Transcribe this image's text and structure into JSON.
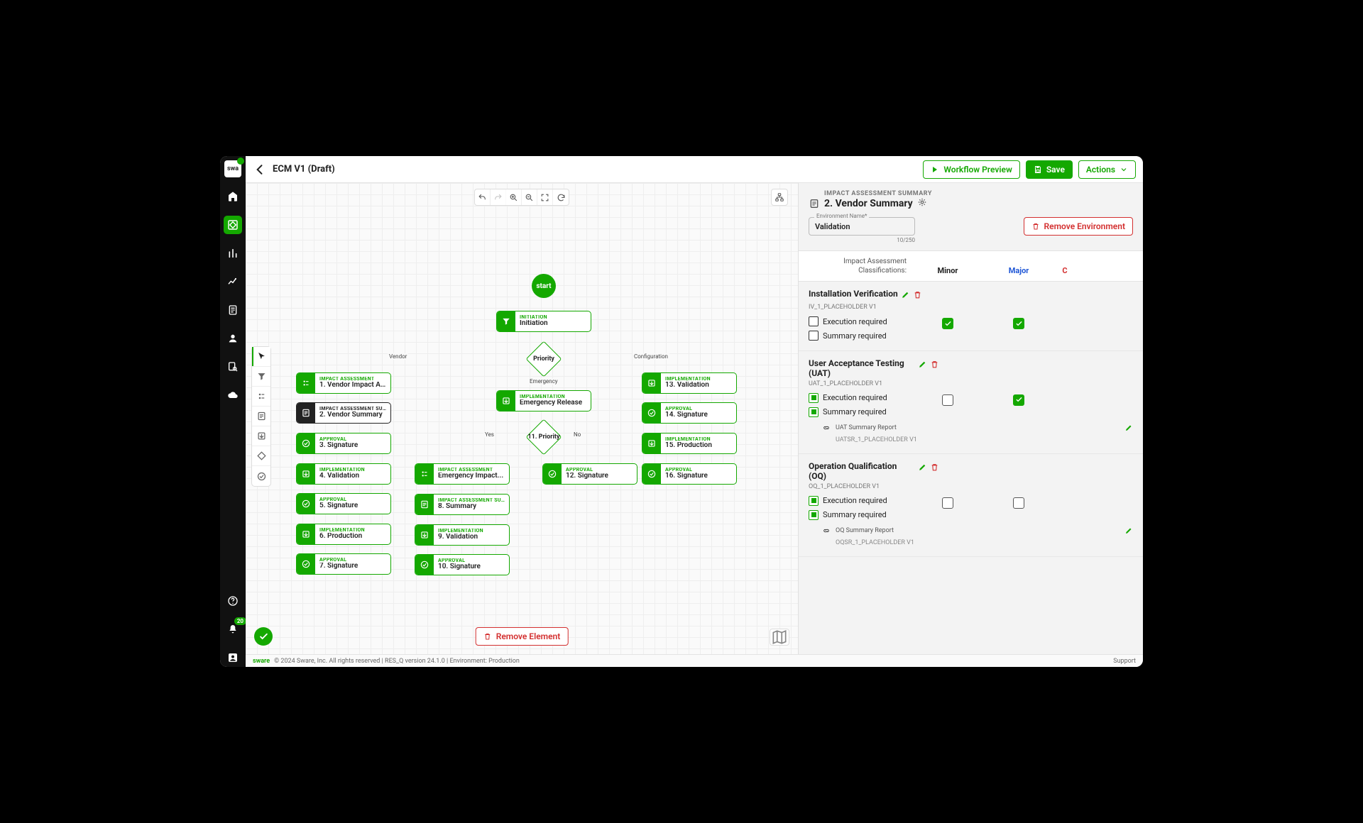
{
  "page": {
    "title": "ECM V1 (Draft)"
  },
  "topbar": {
    "preview": "Workflow Preview",
    "save": "Save",
    "actions": "Actions"
  },
  "footer": {
    "brand": "sware",
    "copyright": "© 2024 Sware, Inc. All rights reserved | RES_Q version 24.1.0 | Environment: Production",
    "support": "Support"
  },
  "canvas": {
    "remove_element": "Remove Element",
    "start": "start",
    "diamonds": {
      "priority": "Priority",
      "priority2": "11. Priority"
    },
    "edge_labels": {
      "vendor": "Vendor",
      "configuration": "Configuration",
      "emergency": "Emergency",
      "yes": "Yes",
      "no": "No"
    },
    "nodes": {
      "initiation": {
        "cat": "INITIATION",
        "lbl": "Initiation"
      },
      "n1": {
        "cat": "IMPACT ASSESSMENT",
        "lbl": "1. Vendor Impact A..."
      },
      "n2": {
        "cat": "IMPACT ASSESSMENT SUMMARY",
        "lbl": "2. Vendor Summary"
      },
      "n3": {
        "cat": "APPROVAL",
        "lbl": "3. Signature"
      },
      "n4": {
        "cat": "IMPLEMENTATION",
        "lbl": "4. Validation"
      },
      "n5": {
        "cat": "APPROVAL",
        "lbl": "5. Signature"
      },
      "n6": {
        "cat": "IMPLEMENTATION",
        "lbl": "6. Production"
      },
      "n7": {
        "cat": "APPROVAL",
        "lbl": "7. Signature"
      },
      "nER": {
        "cat": "IMPLEMENTATION",
        "lbl": "Emergency Release"
      },
      "nEI": {
        "cat": "IMPACT ASSESSMENT",
        "lbl": "Emergency Impact..."
      },
      "n8": {
        "cat": "IMPACT ASSESSMENT SUMMARY",
        "lbl": "8. Summary"
      },
      "n9": {
        "cat": "IMPLEMENTATION",
        "lbl": "9. Validation"
      },
      "n10": {
        "cat": "APPROVAL",
        "lbl": "10. Signature"
      },
      "n12": {
        "cat": "APPROVAL",
        "lbl": "12. Signature"
      },
      "n13": {
        "cat": "IMPLEMENTATION",
        "lbl": "13. Validation"
      },
      "n14": {
        "cat": "APPROVAL",
        "lbl": "14. Signature"
      },
      "n15": {
        "cat": "IMPLEMENTATION",
        "lbl": "15. Production"
      },
      "n16": {
        "cat": "APPROVAL",
        "lbl": "16. Signature"
      }
    }
  },
  "panel": {
    "crumb": "IMPACT ASSESSMENT SUMMARY",
    "heading": "2. Vendor Summary",
    "env_label": "Environment Name*",
    "env_value": "Validation",
    "env_counter": "10/250",
    "remove_env": "Remove Environment",
    "class_header": {
      "lhs": "Impact Assessment Classifications:",
      "minor": "Minor",
      "major": "Major",
      "crit": "C"
    },
    "opts": {
      "exec": "Execution required",
      "summ": "Summary required"
    },
    "sections": {
      "iv": {
        "title": "Installation Verification",
        "sub": "IV_1_PLACEHOLDER V1"
      },
      "uat": {
        "title": "User Acceptance Testing (UAT)",
        "sub": "UAT_1_PLACEHOLDER V1",
        "report_name": "UAT Summary Report",
        "report_place": "UATSR_1_PLACEHOLDER V1"
      },
      "oq": {
        "title": "Operation Qualification (OQ)",
        "sub": "OQ_1_PLACEHOLDER V1",
        "report_name": "OQ Summary Report",
        "report_place": "OQSR_1_PLACEHOLDER V1"
      }
    },
    "rail_badge": "20"
  }
}
